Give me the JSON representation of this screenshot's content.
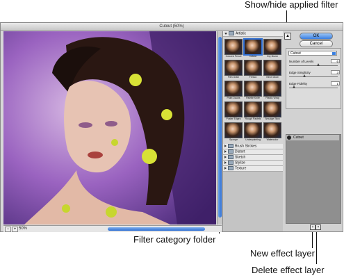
{
  "callouts": {
    "show_hide": "Show/hide applied filter",
    "filter_category": "Filter category folder",
    "new_effect": "New effect layer",
    "delete_effect": "Delete effect layer"
  },
  "window": {
    "title": "Cutout (50%)"
  },
  "preview": {
    "zoom": "50%",
    "minus": "−",
    "plus": "+"
  },
  "filters": {
    "open_category": "Artistic",
    "thumbnails": [
      {
        "label": "Colored Pencil"
      },
      {
        "label": "Cutout"
      },
      {
        "label": "Dry Brush"
      },
      {
        "label": "Film Grain"
      },
      {
        "label": "Fresco"
      },
      {
        "label": "Neon Glow"
      },
      {
        "label": "Paint Daubs"
      },
      {
        "label": "Palette Knife"
      },
      {
        "label": "Plastic Wrap"
      },
      {
        "label": "Poster Edges"
      },
      {
        "label": "Rough Pastels"
      },
      {
        "label": "Smudge Stick"
      },
      {
        "label": "Sponge"
      },
      {
        "label": "Underpainting"
      },
      {
        "label": "Watercolor"
      }
    ],
    "categories": [
      "Brush Strokes",
      "Distort",
      "Sketch",
      "Stylize",
      "Texture"
    ]
  },
  "panel": {
    "ok": "OK",
    "cancel": "Cancel",
    "filter_select": "Cutout",
    "params": [
      {
        "label": "Number of Levels",
        "value": "6"
      },
      {
        "label": "Edge Simplicity",
        "value": "3"
      },
      {
        "label": "Edge Fidelity",
        "value": "1"
      }
    ],
    "layer": "Cutout"
  }
}
